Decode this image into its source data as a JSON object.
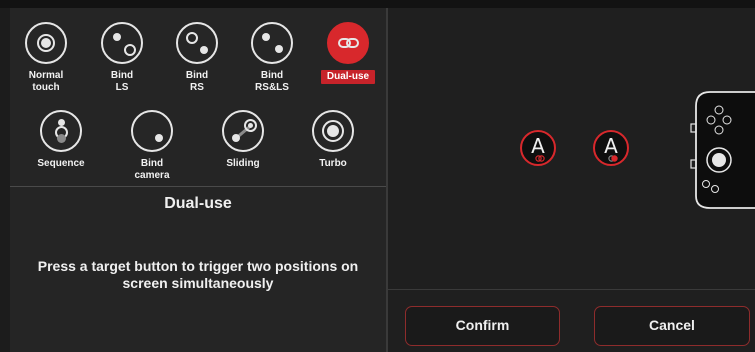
{
  "modes_row1": [
    {
      "label": "Normal\ntouch",
      "icon": "normal-touch-icon"
    },
    {
      "label": "Bind\nLS",
      "icon": "bind-ls-icon"
    },
    {
      "label": "Bind\nRS",
      "icon": "bind-rs-icon"
    },
    {
      "label": "Bind\nRS&LS",
      "icon": "bind-rsls-icon"
    },
    {
      "label": "Dual-use",
      "icon": "dual-use-icon",
      "selected": true
    }
  ],
  "modes_row2": [
    {
      "label": "Sequence",
      "icon": "sequence-icon"
    },
    {
      "label": "Bind\ncamera",
      "icon": "bind-camera-icon"
    },
    {
      "label": "Sliding",
      "icon": "sliding-icon"
    },
    {
      "label": "Turbo",
      "icon": "turbo-icon"
    }
  ],
  "detail": {
    "title": "Dual-use",
    "description": "Press a target button to trigger two positions on screen simultaneously"
  },
  "preview": {
    "button_1": "A",
    "button_2": "A"
  },
  "actions": {
    "confirm": "Confirm",
    "cancel": "Cancel"
  },
  "colors": {
    "accent": "#d8282c",
    "background": "#1c1c1c",
    "panel": "#252525"
  }
}
